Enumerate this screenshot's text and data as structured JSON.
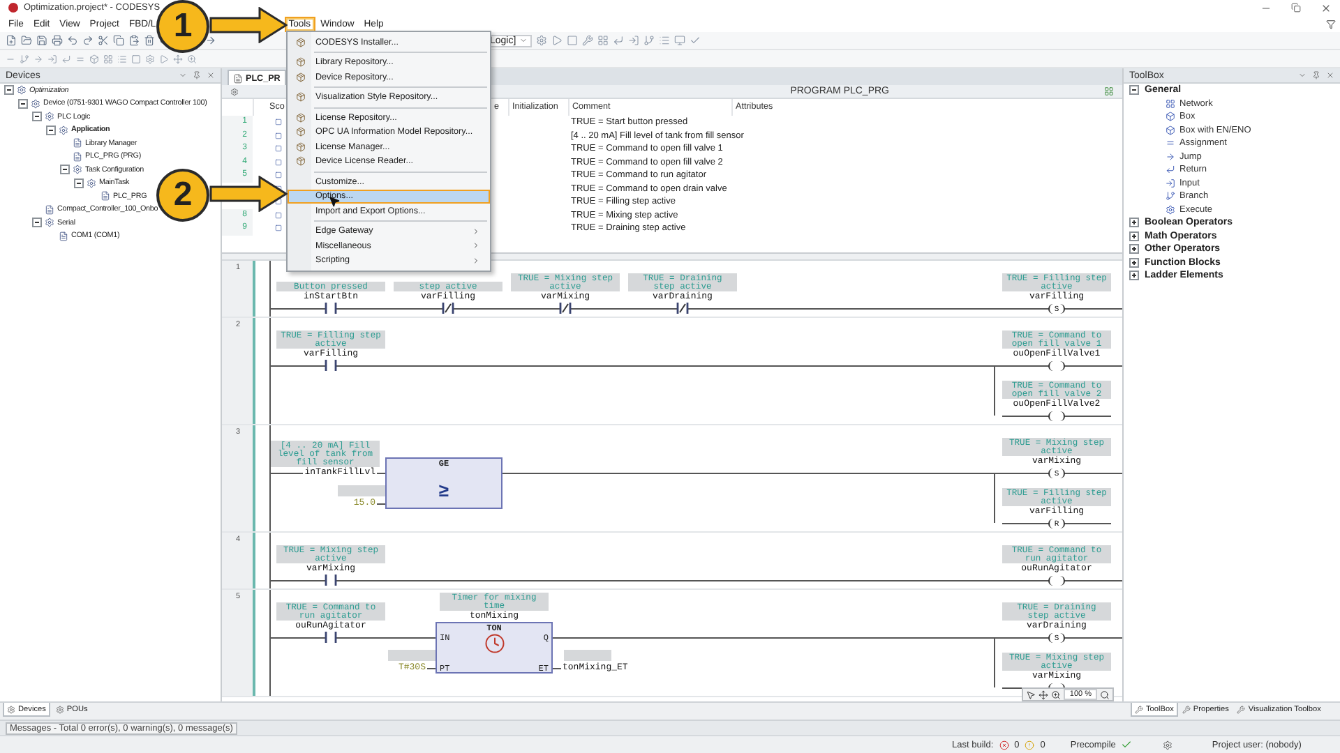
{
  "window": {
    "title": "Optimization.project* - CODESYS"
  },
  "menu_bar": [
    {
      "label": "File",
      "selected": false
    },
    {
      "label": "Edit",
      "selected": false
    },
    {
      "label": "View",
      "selected": false
    },
    {
      "label": "Project",
      "selected": false
    },
    {
      "label": "FBD/L",
      "selected": false
    },
    {
      "label": "Tools",
      "selected": true
    },
    {
      "label": "Window",
      "selected": false
    },
    {
      "label": "Help",
      "selected": false
    }
  ],
  "toolbar": {
    "combo_value": "Logic]"
  },
  "tools_menu": {
    "groups": [
      [
        {
          "label": "CODESYS Installer...",
          "selected": false,
          "submenu": false
        }
      ],
      [
        {
          "label": "Library Repository...",
          "selected": false,
          "submenu": false
        },
        {
          "label": "Device Repository...",
          "selected": false,
          "submenu": false
        }
      ],
      [
        {
          "label": "Visualization Style Repository...",
          "selected": false,
          "submenu": false
        }
      ],
      [
        {
          "label": "License Repository...",
          "selected": false,
          "submenu": false
        },
        {
          "label": "OPC UA Information Model Repository...",
          "selected": false,
          "submenu": false
        },
        {
          "label": "License Manager...",
          "selected": false,
          "submenu": false
        },
        {
          "label": "Device License Reader...",
          "selected": false,
          "submenu": false
        }
      ],
      [
        {
          "label": "Customize...",
          "selected": false,
          "submenu": false
        },
        {
          "label": "Options...",
          "selected": true,
          "submenu": false
        },
        {
          "label": "Import and Export Options...",
          "selected": false,
          "submenu": false
        }
      ],
      [
        {
          "label": "Edge Gateway",
          "selected": false,
          "submenu": true
        },
        {
          "label": "Miscellaneous",
          "selected": false,
          "submenu": true
        },
        {
          "label": "Scripting",
          "selected": false,
          "submenu": true
        }
      ]
    ]
  },
  "annotations": [
    {
      "label": "1"
    },
    {
      "label": "2"
    }
  ],
  "devices_panel": {
    "title": "Devices",
    "tree": [
      {
        "label": "Optimization",
        "kind": "project",
        "expanded": true,
        "children": [
          {
            "label": "Device (0751-9301 WAGO Compact Controller 100)",
            "kind": "item",
            "expanded": true,
            "children": [
              {
                "label": "PLC Logic",
                "kind": "item",
                "expanded": true,
                "children": [
                  {
                    "label": "Application",
                    "kind": "application",
                    "expanded": true,
                    "children": [
                      {
                        "label": "Library Manager",
                        "kind": "item"
                      },
                      {
                        "label": "PLC_PRG (PRG)",
                        "kind": "item"
                      },
                      {
                        "label": "Task Configuration",
                        "kind": "item",
                        "expanded": true,
                        "children": [
                          {
                            "label": "MainTask",
                            "kind": "item",
                            "expanded": true,
                            "children": [
                              {
                                "label": "PLC_PRG",
                                "kind": "item"
                              }
                            ]
                          }
                        ]
                      }
                    ]
                  }
                ]
              },
              {
                "label": "Compact_Controller_100_Onbo",
                "kind": "item"
              },
              {
                "label": "Serial",
                "kind": "item",
                "expanded": true,
                "children": [
                  {
                    "label": "COM1 (COM1)",
                    "kind": "item"
                  }
                ]
              }
            ]
          }
        ]
      }
    ]
  },
  "editor": {
    "tab": {
      "label": "PLC_PR",
      "selected": true
    },
    "header": "PROGRAM PLC_PRG",
    "variables": {
      "columns": [
        "Sco",
        "e",
        "Initialization",
        "Comment",
        "Attributes"
      ],
      "rows": [
        {
          "number": "1",
          "comment": "TRUE = Start button pressed"
        },
        {
          "number": "2",
          "comment": "[4 .. 20 mA] Fill level of tank from fill sensor"
        },
        {
          "number": "3",
          "comment": "TRUE = Command to open fill valve 1"
        },
        {
          "number": "4",
          "comment": "TRUE = Command to open fill valve 2"
        },
        {
          "number": "5",
          "comment": "TRUE = Command to run agitator"
        },
        {
          "comment": "TRUE = Command to open drain valve"
        },
        {
          "comment": "TRUE = Filling step active"
        },
        {
          "number": "8",
          "comment": "TRUE = Mixing step active"
        },
        {
          "number": "9",
          "comment": "TRUE = Draining step active"
        }
      ]
    },
    "networks": [
      {
        "number": "1",
        "elements": [
          {
            "kind": "contact",
            "comment": "Button pressed",
            "name": "inStartBtn",
            "negated": false
          },
          {
            "kind": "contact",
            "comment": "step active",
            "name": "varFilling",
            "negated": true
          },
          {
            "kind": "contact",
            "comment": "TRUE = Mixing step active",
            "name": "varMixing",
            "negated": true
          },
          {
            "kind": "contact",
            "comment": "TRUE = Draining step active",
            "name": "varDraining",
            "negated": true
          }
        ],
        "coils": [
          {
            "comment": "TRUE = Filling step active",
            "name": "varFilling",
            "symbol": "S"
          }
        ]
      },
      {
        "number": "2",
        "elements": [
          {
            "kind": "contact",
            "comment": "TRUE = Filling step active",
            "name": "varFilling",
            "negated": false
          }
        ],
        "coils": [
          {
            "comment": "TRUE = Command to open fill valve 1",
            "name": "ouOpenFillValve1"
          },
          {
            "comment": "TRUE = Command to open fill valve 2",
            "name": "ouOpenFillValve2"
          }
        ]
      },
      {
        "number": "3",
        "elements": [
          {
            "kind": "block",
            "title": "GE",
            "symbol": "≥",
            "inputs": [
              {
                "comment": "[4 .. 20 mA] Fill level of tank from fill sensor",
                "name": "inTankFillLvl",
                "kind": "variable"
              },
              {
                "name": "15.0",
                "kind": "literal",
                "comment_box": true
              }
            ]
          }
        ],
        "coils": [
          {
            "comment": "TRUE = Mixing step active",
            "name": "varMixing",
            "symbol": "S"
          },
          {
            "comment": "TRUE = Filling step active",
            "name": "varFilling",
            "symbol": "R"
          }
        ]
      },
      {
        "number": "4",
        "elements": [
          {
            "kind": "contact",
            "comment": "TRUE = Mixing step active",
            "name": "varMixing",
            "negated": false
          }
        ],
        "coils": [
          {
            "comment": "TRUE = Command to run agitator",
            "name": "ouRunAgitator"
          }
        ]
      },
      {
        "number": "5",
        "elements": [
          {
            "kind": "contact",
            "comment": "TRUE = Command to run agitator",
            "name": "ouRunAgitator",
            "negated": false
          },
          {
            "kind": "block",
            "title": "TON",
            "comment": "Timer for mixing time",
            "instance": "tonMixing",
            "inputs": [
              {
                "pin": "IN"
              },
              {
                "pin": "PT",
                "name": "T#30S",
                "kind": "literal",
                "comment_box": true
              }
            ],
            "outputs": [
              {
                "pin": "Q"
              },
              {
                "pin": "ET",
                "name": "tonMixing_ET",
                "kind": "variable",
                "comment_box": true
              }
            ]
          }
        ],
        "coils": [
          {
            "comment": "TRUE = Draining step active",
            "name": "varDraining",
            "symbol": "S"
          },
          {
            "comment": "TRUE = Mixing step active",
            "name": "varMixing"
          }
        ]
      }
    ],
    "zoom": "100 %"
  },
  "toolbox": {
    "title": "ToolBox",
    "groups": [
      {
        "label": "General",
        "expanded": true,
        "items": [
          "Network",
          "Box",
          "Box with EN/ENO",
          "Assignment",
          "Jump",
          "Return",
          "Input",
          "Branch",
          "Execute"
        ]
      },
      {
        "label": "Boolean Operators",
        "expanded": false
      },
      {
        "label": "Math Operators",
        "expanded": false
      },
      {
        "label": "Other Operators",
        "expanded": false
      },
      {
        "label": "Function Blocks",
        "expanded": false
      },
      {
        "label": "Ladder Elements",
        "expanded": false
      }
    ]
  },
  "left_tabs": [
    {
      "label": "Devices",
      "selected": true
    },
    {
      "label": "POUs",
      "selected": false
    }
  ],
  "right_tabs": [
    {
      "label": "ToolBox",
      "selected": true
    },
    {
      "label": "Properties",
      "selected": false
    },
    {
      "label": "Visualization Toolbox",
      "selected": false
    }
  ],
  "messages": "Messages - Total 0 error(s), 0 warning(s), 0 message(s)",
  "status_bar": {
    "last_build": "Last build:",
    "errors": "0",
    "warnings": "0",
    "precompile": "Precompile",
    "user": "Project user: (nobody)"
  }
}
